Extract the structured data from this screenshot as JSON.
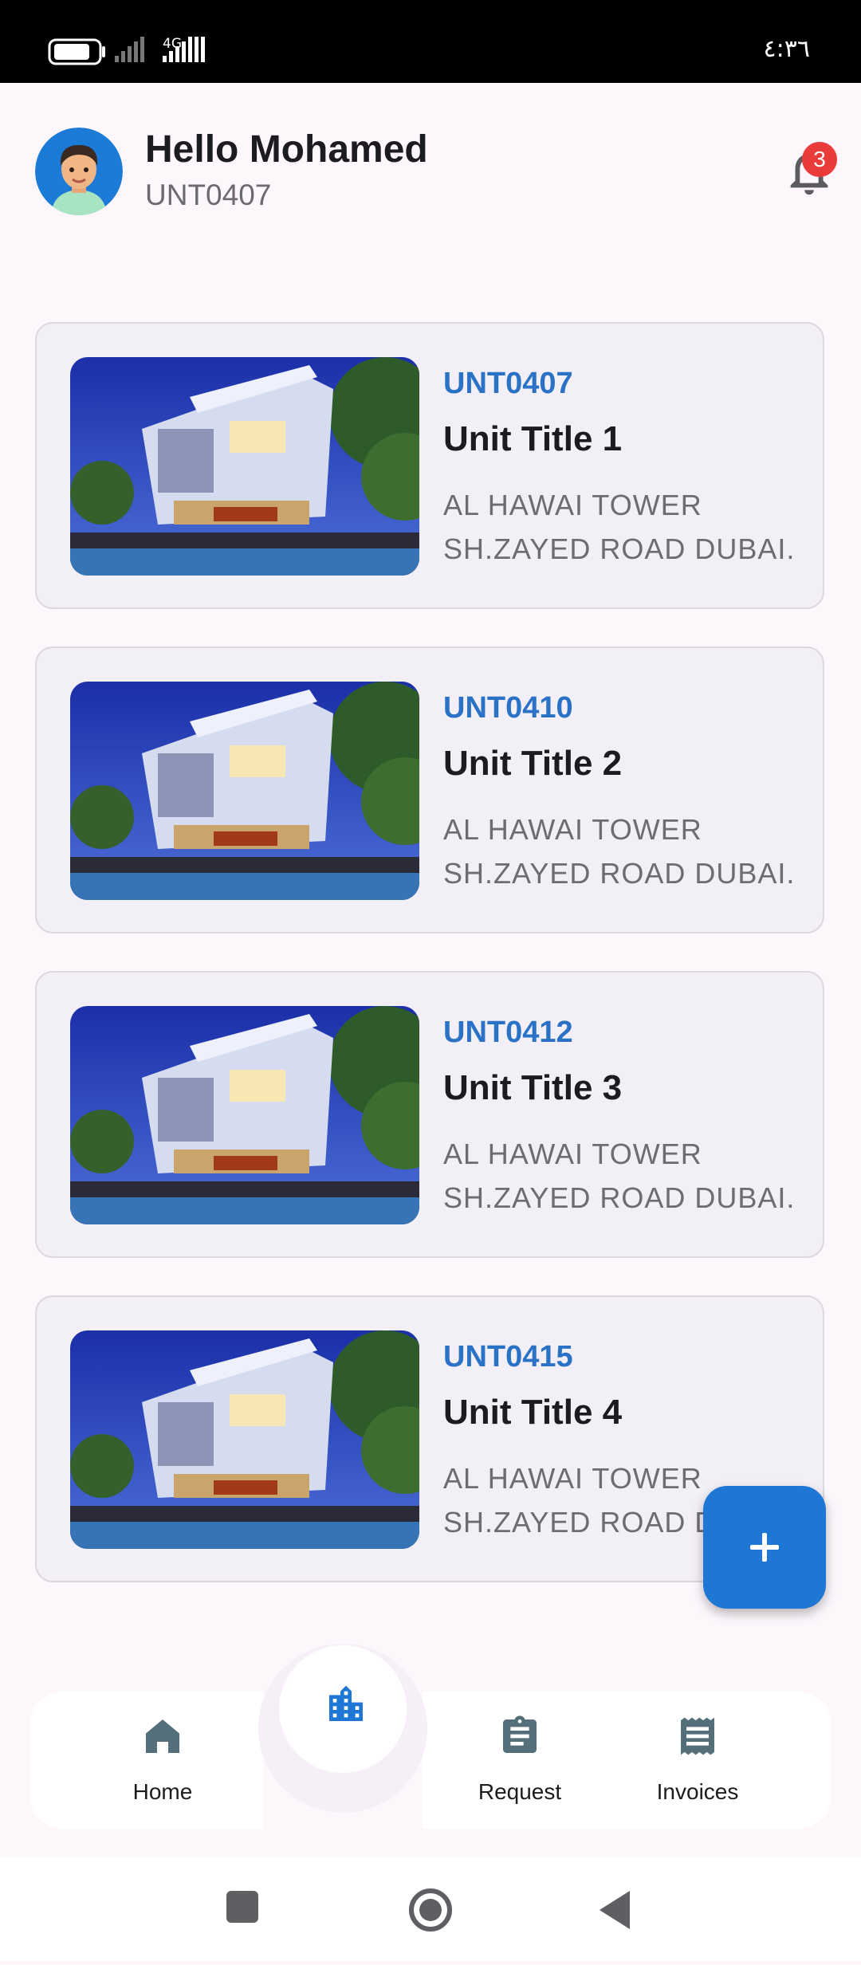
{
  "status_bar": {
    "time": "٤:٣٦",
    "network": "4G"
  },
  "header": {
    "greeting": "Hello Mohamed",
    "unit_code": "UNT0407",
    "notification_count": "3"
  },
  "units": [
    {
      "code": "UNT0407",
      "title": "Unit Title 1",
      "address_line1": "AL HAWAI TOWER",
      "address_line2": "SH.ZAYED ROAD DUBAI."
    },
    {
      "code": "UNT0410",
      "title": "Unit Title 2",
      "address_line1": "AL HAWAI TOWER",
      "address_line2": "SH.ZAYED ROAD DUBAI."
    },
    {
      "code": "UNT0412",
      "title": "Unit Title 3",
      "address_line1": "AL HAWAI TOWER",
      "address_line2": "SH.ZAYED ROAD DUBAI."
    },
    {
      "code": "UNT0415",
      "title": "Unit Title 4",
      "address_line1": "AL HAWAI TOWER",
      "address_line2": "SH.ZAYED ROAD DUBAI."
    }
  ],
  "fab": {
    "icon": "plus-icon"
  },
  "bottom_nav": {
    "home": {
      "label": "Home",
      "icon": "home-icon"
    },
    "center": {
      "icon": "building-icon"
    },
    "request": {
      "label": "Request",
      "icon": "clipboard-icon"
    },
    "invoices": {
      "label": "Invoices",
      "icon": "receipt-icon"
    }
  },
  "colors": {
    "accent": "#1E77D4",
    "badge": "#EA3B3B",
    "code_text": "#2A72C6",
    "nav_icon": "#546E7A"
  }
}
